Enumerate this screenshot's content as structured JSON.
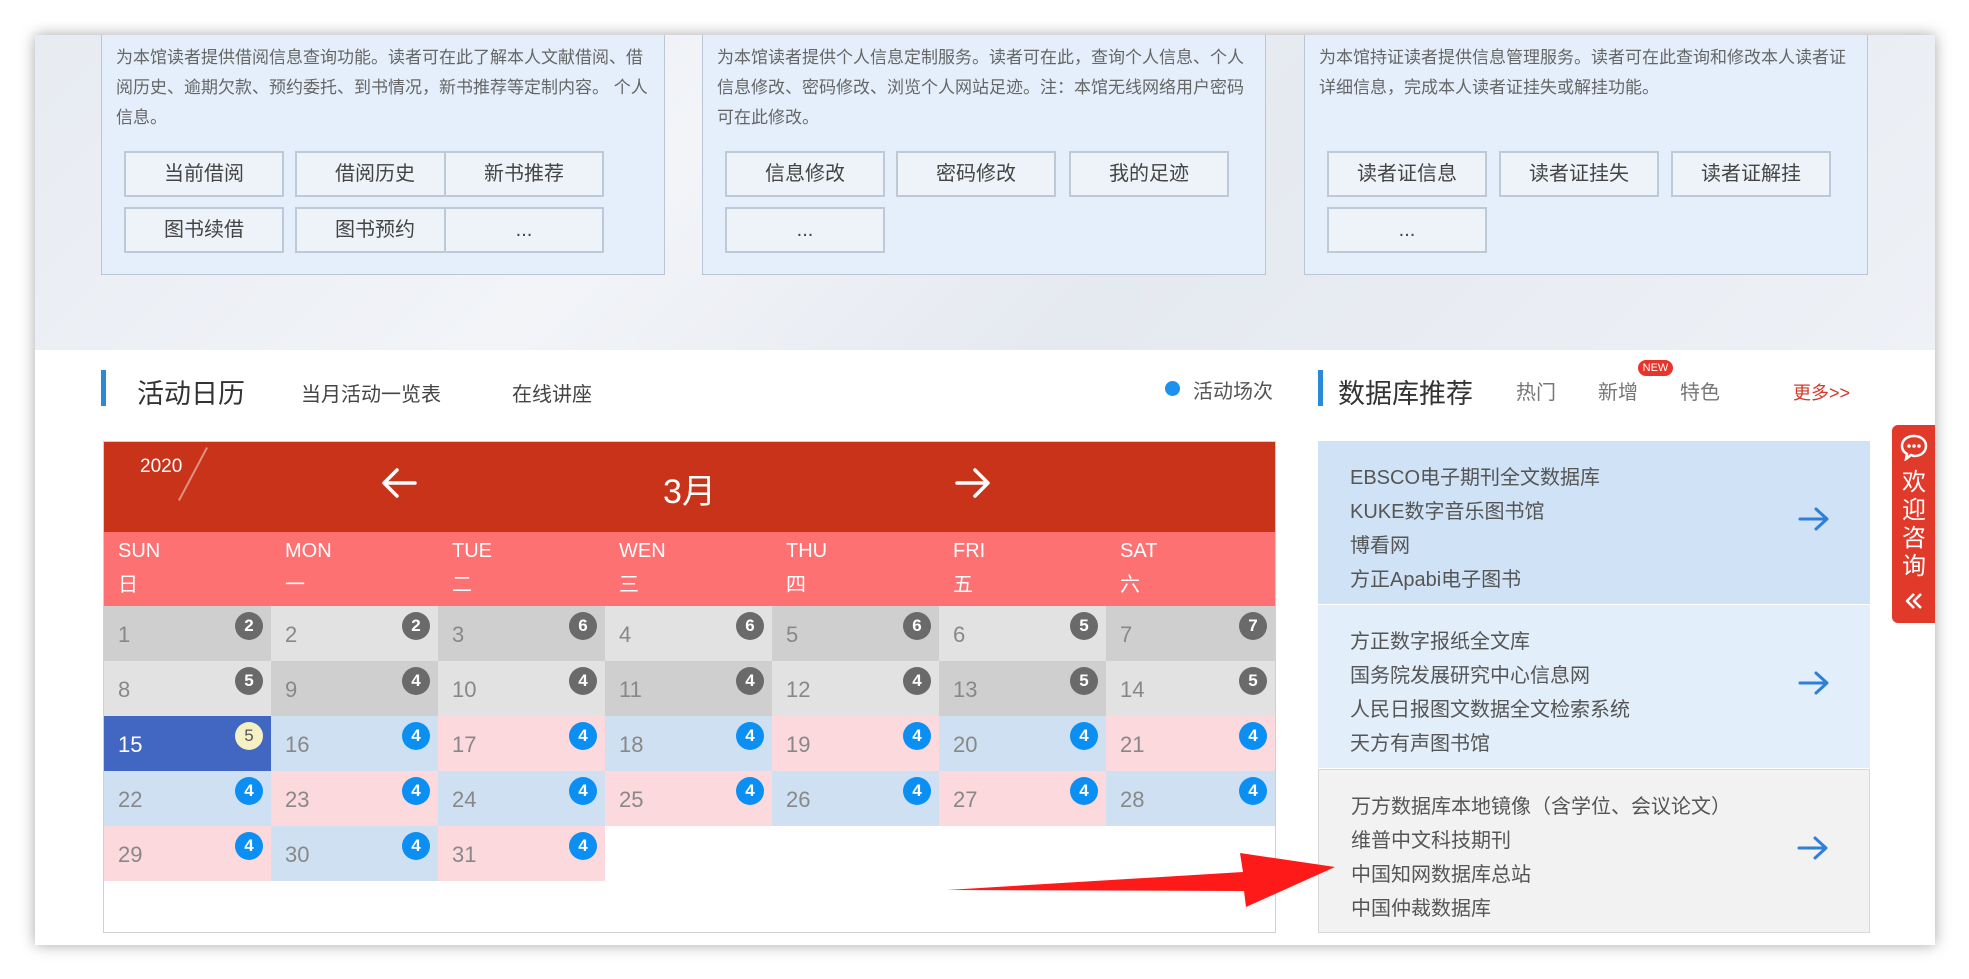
{
  "services": [
    {
      "description": "为本馆读者提供借阅信息查询功能。读者可在此了解本人文献借阅、借阅历史、逾期欠款、预约委托、到书情况，新书推荐等定制内容。 个人信息。",
      "buttons": [
        "当前借阅",
        "借阅历史",
        "新书推荐",
        "图书续借",
        "图书预约",
        "..."
      ]
    },
    {
      "description": "为本馆读者提供个人信息定制服务。读者可在此，查询个人信息、个人信息修改、密码修改、浏览个人网站足迹。注：本馆无线网络用户密码可在此修改。",
      "buttons": [
        "信息修改",
        "密码修改",
        "我的足迹",
        "..."
      ]
    },
    {
      "description": "为本馆持证读者提供信息管理服务。读者可在此查询和修改本人读者证详细信息，完成本人读者证挂失或解挂功能。",
      "buttons": [
        "读者证信息",
        "读者证挂失",
        "读者证解挂",
        "..."
      ]
    }
  ],
  "calendar_section": {
    "title": "活动日历",
    "links": [
      "当月活动一览表",
      "在线讲座"
    ],
    "legend": "活动场次"
  },
  "calendar": {
    "year": "2020",
    "month": "3月",
    "weekdays": [
      {
        "en": "SUN",
        "cn": "日"
      },
      {
        "en": "MON",
        "cn": "一"
      },
      {
        "en": "TUE",
        "cn": "二"
      },
      {
        "en": "WEN",
        "cn": "三"
      },
      {
        "en": "THU",
        "cn": "四"
      },
      {
        "en": "FRI",
        "cn": "五"
      },
      {
        "en": "SAT",
        "cn": "六"
      }
    ],
    "days": [
      {
        "d": "1",
        "n": "2",
        "s": "past1"
      },
      {
        "d": "2",
        "n": "2",
        "s": "past2"
      },
      {
        "d": "3",
        "n": "6",
        "s": "past1"
      },
      {
        "d": "4",
        "n": "6",
        "s": "past2"
      },
      {
        "d": "5",
        "n": "6",
        "s": "past1"
      },
      {
        "d": "6",
        "n": "5",
        "s": "past2"
      },
      {
        "d": "7",
        "n": "7",
        "s": "past1"
      },
      {
        "d": "8",
        "n": "5",
        "s": "past2"
      },
      {
        "d": "9",
        "n": "4",
        "s": "past1"
      },
      {
        "d": "10",
        "n": "4",
        "s": "past2"
      },
      {
        "d": "11",
        "n": "4",
        "s": "past1"
      },
      {
        "d": "12",
        "n": "4",
        "s": "past2"
      },
      {
        "d": "13",
        "n": "5",
        "s": "past1"
      },
      {
        "d": "14",
        "n": "5",
        "s": "past2"
      },
      {
        "d": "15",
        "n": "5",
        "s": "today"
      },
      {
        "d": "16",
        "n": "4",
        "s": "blue"
      },
      {
        "d": "17",
        "n": "4",
        "s": "pink"
      },
      {
        "d": "18",
        "n": "4",
        "s": "blue"
      },
      {
        "d": "19",
        "n": "4",
        "s": "pink"
      },
      {
        "d": "20",
        "n": "4",
        "s": "blue"
      },
      {
        "d": "21",
        "n": "4",
        "s": "pink"
      },
      {
        "d": "22",
        "n": "4",
        "s": "blue"
      },
      {
        "d": "23",
        "n": "4",
        "s": "pink"
      },
      {
        "d": "24",
        "n": "4",
        "s": "blue"
      },
      {
        "d": "25",
        "n": "4",
        "s": "pink"
      },
      {
        "d": "26",
        "n": "4",
        "s": "blue"
      },
      {
        "d": "27",
        "n": "4",
        "s": "pink"
      },
      {
        "d": "28",
        "n": "4",
        "s": "blue"
      },
      {
        "d": "29",
        "n": "4",
        "s": "pink"
      },
      {
        "d": "30",
        "n": "4",
        "s": "blue"
      },
      {
        "d": "31",
        "n": "4",
        "s": "pink"
      }
    ]
  },
  "database_section": {
    "title": "数据库推荐",
    "tabs": [
      "热门",
      "新增",
      "特色"
    ],
    "new_badge": "NEW",
    "more": "更多>>",
    "panels": [
      [
        "EBSCO电子期刊全文数据库",
        "KUKE数字音乐图书馆",
        "博看网",
        "方正Apabi电子图书"
      ],
      [
        "方正数字报纸全文库",
        "国务院发展研究中心信息网",
        "人民日报图文数据全文检索系统",
        "天方有声图书馆"
      ],
      [
        "万方数据库本地镜像（含学位、会议论文）",
        "维普中文科技期刊",
        "中国知网数据库总站",
        "中国仲裁数据库"
      ]
    ]
  },
  "consult": {
    "label": "欢迎咨询"
  },
  "colors": {
    "calendar_header": "#c8331a",
    "weekday_row": "#fd7172",
    "today": "#4267c2",
    "badge_blue": "#0b8ff2",
    "accent_bar": "#2a8ad8",
    "annotation_arrow": "#ff1a1a"
  },
  "icons": {
    "prev_month": "arrow-left-icon",
    "next_month": "arrow-right-icon",
    "panel_go": "arrow-right-icon",
    "consult": "chat-bubble-icon",
    "collapse": "double-chevron-left-icon"
  }
}
